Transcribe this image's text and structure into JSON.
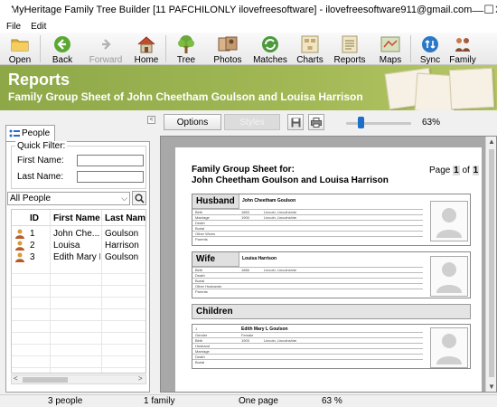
{
  "window": {
    "title": "MyHeritage Family Tree Builder [11 PAFCHILONLY ilovefreesoftware] - ilovefreesoftware911@gmail.com",
    "minimize": "—",
    "maximize": "☐",
    "close": "✕"
  },
  "menu": {
    "items": [
      "File",
      "Edit"
    ]
  },
  "toolbar": {
    "buttons": [
      {
        "label": "Open",
        "icon": "folder-icon"
      },
      {
        "label": "Back",
        "icon": "back-arrow-icon"
      },
      {
        "label": "Forward",
        "icon": "forward-arrow-icon",
        "disabled": true
      },
      {
        "label": "Home",
        "icon": "home-icon"
      },
      {
        "label": "Tree",
        "icon": "tree-icon"
      },
      {
        "label": "Photos",
        "icon": "photos-icon"
      },
      {
        "label": "Matches",
        "icon": "matches-icon"
      },
      {
        "label": "Charts",
        "icon": "charts-icon"
      },
      {
        "label": "Reports",
        "icon": "reports-icon"
      },
      {
        "label": "Maps",
        "icon": "maps-icon"
      },
      {
        "label": "Sync",
        "icon": "sync-icon"
      },
      {
        "label": "Family",
        "icon": "family-icon"
      }
    ]
  },
  "banner": {
    "title": "Reports",
    "subtitle": "Family Group Sheet of John Cheetham Goulson and Louisa Harrison"
  },
  "people_panel": {
    "tab_label": "People",
    "collapse": "<",
    "quick_filter": {
      "legend": "Quick Filter:",
      "first_name_label": "First Name:",
      "last_name_label": "Last Name:",
      "first_name_value": "",
      "last_name_value": ""
    },
    "filter_select": "All People",
    "columns": [
      "ID",
      "First Name",
      "Last Name"
    ],
    "rows": [
      {
        "id": "1",
        "first": "John Che...",
        "last": "Goulson"
      },
      {
        "id": "2",
        "first": "Louisa",
        "last": "Harrison"
      },
      {
        "id": "3",
        "first": "Edith Mary L.",
        "last": "Goulson"
      }
    ]
  },
  "report_toolbar": {
    "options_label": "Options",
    "styles_label": "Styles",
    "zoom_text": "63%",
    "zoom_level": 0.63
  },
  "preview": {
    "heading_line1": "Family Group Sheet for:",
    "heading_line2": "John Cheetham Goulson and Louisa Harrison",
    "page_prefix": "Page",
    "page_current": "1",
    "page_of": "of",
    "page_total": "1",
    "husband": {
      "header": "Husband",
      "name": "John Cheetham Goulson",
      "fields": [
        {
          "label": "Birth",
          "date": "1863",
          "place": "Lincoln, Lincolnshire"
        },
        {
          "label": "Marriage",
          "date": "1900",
          "place": "Lincoln, Lincolnshire"
        },
        {
          "label": "Death",
          "date": "",
          "place": ""
        },
        {
          "label": "Burial",
          "date": "",
          "place": ""
        },
        {
          "label": "Other Wives",
          "date": "",
          "place": ""
        },
        {
          "label": "Parents",
          "date": "",
          "place": ""
        }
      ]
    },
    "wife": {
      "header": "Wife",
      "name": "Louisa Harrison",
      "fields": [
        {
          "label": "Birth",
          "date": "1866",
          "place": "Lincoln, Lincolnshire"
        },
        {
          "label": "Death",
          "date": "",
          "place": ""
        },
        {
          "label": "Burial",
          "date": "",
          "place": ""
        },
        {
          "label": "Other Husbands",
          "date": "",
          "place": ""
        },
        {
          "label": "Parents",
          "date": "",
          "place": ""
        }
      ]
    },
    "children": {
      "header": "Children",
      "child_index": "1",
      "child_name": "Edith Mary L Goulson",
      "fields": [
        {
          "label": "Gender",
          "date": "Female",
          "place": ""
        },
        {
          "label": "Birth",
          "date": "1903",
          "place": "Lincoln, Lincolnshire"
        },
        {
          "label": "Husband",
          "date": "",
          "place": ""
        },
        {
          "label": "Marriage",
          "date": "",
          "place": ""
        },
        {
          "label": "Death",
          "date": "",
          "place": ""
        },
        {
          "label": "Burial",
          "date": "",
          "place": ""
        }
      ]
    }
  },
  "status": {
    "people": "3 people",
    "families": "1 family",
    "pages": "One page",
    "zoom": "63 %"
  }
}
